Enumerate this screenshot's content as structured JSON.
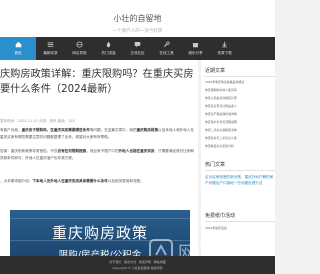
{
  "site": {
    "title": "小壮的自留地",
    "subtitle": "一个简产人的一深亏好转"
  },
  "nav": {
    "items": [
      {
        "label": "首页",
        "active": true
      },
      {
        "label": "最新收录"
      },
      {
        "label": "网址导航"
      },
      {
        "label": "热门流量"
      },
      {
        "label": "交流社区"
      },
      {
        "label": "在线工具"
      },
      {
        "label": "娱乐分享"
      },
      {
        "label": "资源下载"
      }
    ]
  },
  "article": {
    "title": "庆购房政策详解：重庆限购吗？在重庆买房要什么条件（2024最新）",
    "byline": "发布时间：2024-12-11 分类：资讯 阅读：128",
    "p1_prefix": "有客户问我，",
    "p1_bold1": "重庆房子限购吗，在重庆买房需要哪些条件",
    "p1_mid": "等问题，在这篇文章中，我把",
    "p1_bold2": "重庆购房政策",
    "p1_tail": "以及本地人和外地人在重庆买房有哪些需要注意的问题都整理了出来，希望对大家有所帮助。",
    "p2_prefix": "答案：重庆购房政策非常宽松，不仅",
    "p2_bold1": "没有任何限购措施",
    "p2_mid": "，而且有不限户口的",
    "p2_bold2": "外地人也能在重庆买房",
    "p2_tail": "，只需要满足首付比例和贷款条件即可，外地人在重庆落户也非常方便。",
    "p3_prefix": "，大本期详细介绍：",
    "p3_bold": "下本地人及外地人在重庆买房具体需要什么条件",
    "p3_tail": "以及相关费用和流程。",
    "banner_title": "重庆购房政策",
    "banner_sub": "限购/房产税/公积金"
  },
  "sidebar": {
    "recent_title": "近期文章",
    "recent": [
      "2024年重庆购房政策最新解读",
      "重庆限购吗外地人能买吗",
      "重庆公积金贷款额度计算",
      "重庆买房首付比例是多少",
      "重庆房产税征收标准详解",
      "重庆落户条件及流程说明",
      "重庆二手房交易税费清单",
      "重庆新房与二手房怎么选",
      "重庆各区房价走势分析"
    ],
    "hot_title": "热门文章",
    "hot": [
      "应对买房政策的新对策，重庆外地户籍的房产问题及户口落地一些问题处理方法"
    ],
    "links_title": "免费纸巾活动",
    "links": [
      "2024年最新活动"
    ]
  },
  "footer": {
    "line1": "关于我们 · 联系方式 · 免责声明 · 网站地图",
    "line2": "Copyright © 小壮的自留地 版权所有"
  },
  "watermark": {
    "text": "网站目录"
  }
}
